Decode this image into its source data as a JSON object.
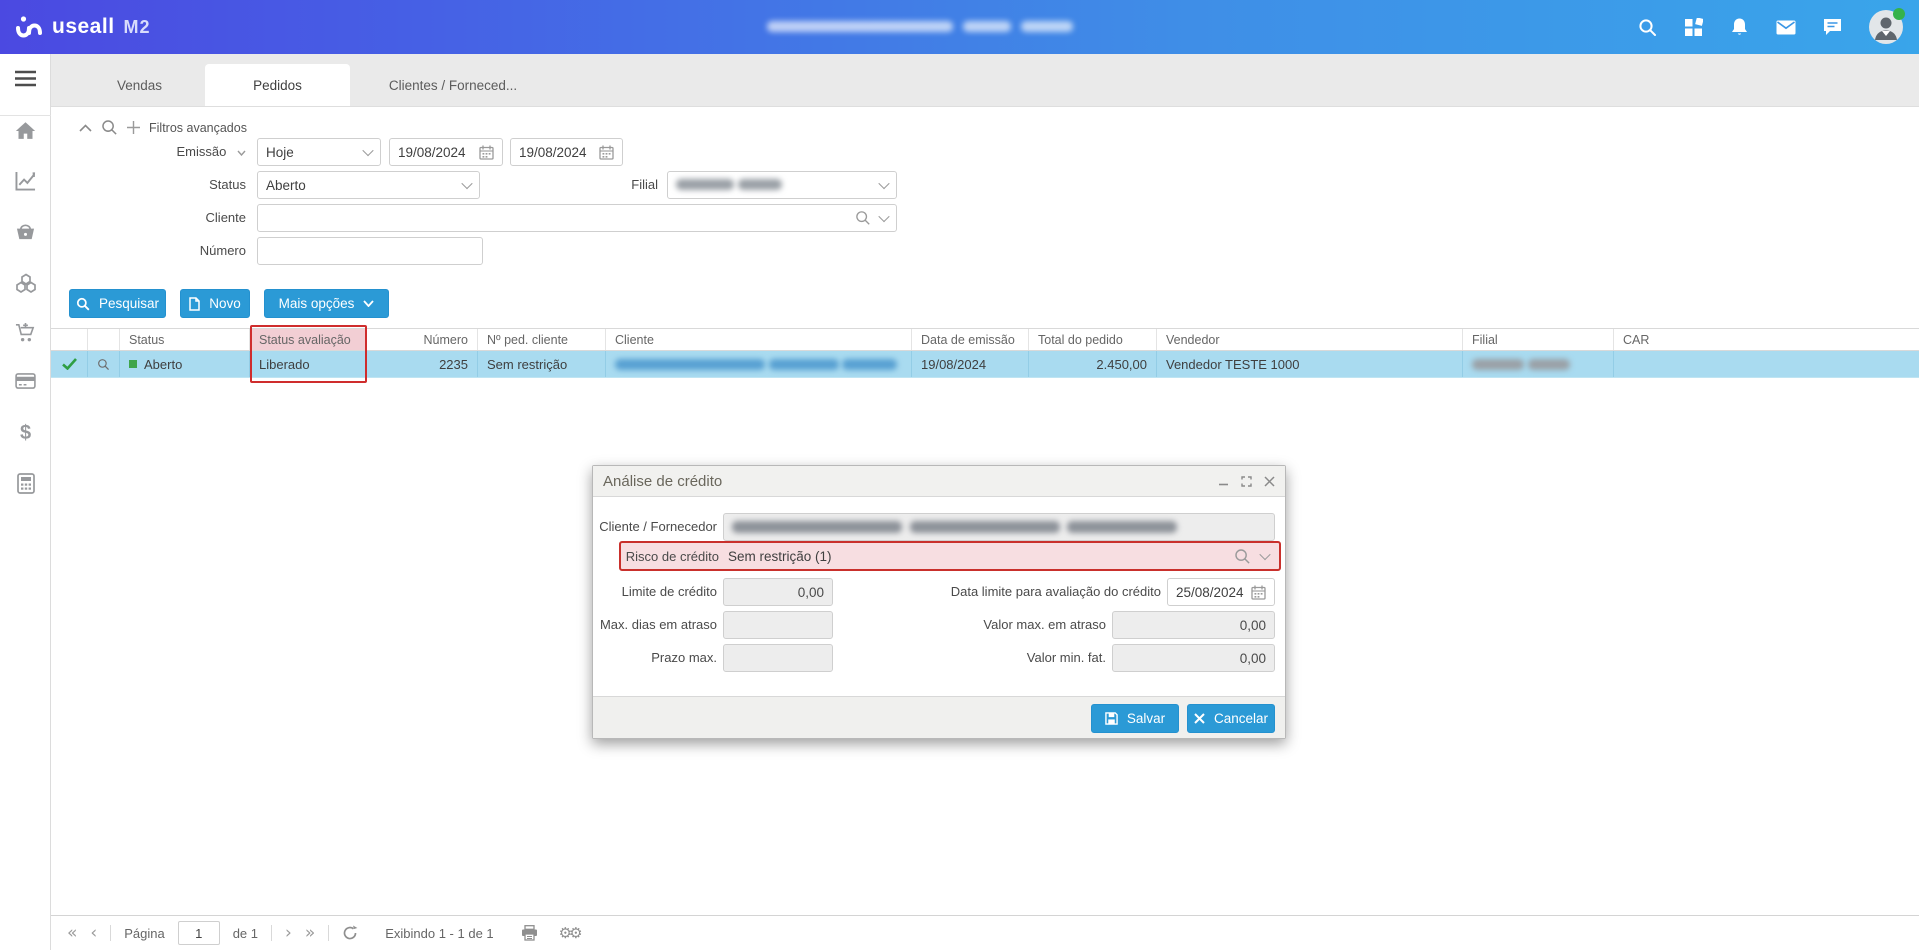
{
  "header": {
    "brand": "useall",
    "product": "M2"
  },
  "tabs": [
    {
      "label": "Vendas"
    },
    {
      "label": "Pedidos"
    },
    {
      "label": "Clientes / Forneced..."
    }
  ],
  "filters": {
    "advanced_label": "Filtros avançados",
    "emissao_label": "Emissão",
    "emissao_preset": "Hoje",
    "date_from": "19/08/2024",
    "date_to": "19/08/2024",
    "status_label": "Status",
    "status_value": "Aberto",
    "filial_label": "Filial",
    "cliente_label": "Cliente",
    "numero_label": "Número"
  },
  "actions": {
    "search": "Pesquisar",
    "new": "Novo",
    "more": "Mais opções"
  },
  "table": {
    "columns": [
      "",
      "",
      "Status",
      "Status avaliação",
      "Número",
      "Nº ped. cliente",
      "Cliente",
      "Data de emissão",
      "Total do pedido",
      "Vendedor",
      "Filial",
      "CAR"
    ],
    "row": {
      "status": "Aberto",
      "status_avaliacao": "Liberado",
      "numero": "2235",
      "n_ped_cliente": "Sem restrição",
      "data_emissao": "19/08/2024",
      "total": "2.450,00",
      "vendedor": "Vendedor TESTE 1000",
      "car": ""
    }
  },
  "modal": {
    "title": "Análise de crédito",
    "cliente_fornecedor_label": "Cliente / Fornecedor",
    "risco_label": "Risco de crédito",
    "risco_value": "Sem restrição (1)",
    "limite_label": "Limite de crédito",
    "limite_value": "0,00",
    "data_limite_label": "Data limite para avaliação do crédito",
    "data_limite_value": "25/08/2024",
    "max_dias_label": "Max. dias em atraso",
    "valor_max_label": "Valor max. em atraso",
    "valor_max_value": "0,00",
    "prazo_label": "Prazo max.",
    "valor_min_label": "Valor min. fat.",
    "valor_min_value": "0,00",
    "save": "Salvar",
    "cancel": "Cancelar"
  },
  "pagination": {
    "page_label": "Página",
    "page_value": "1",
    "of_label": "de 1",
    "showing": "Exibindo 1 - 1 de 1"
  }
}
